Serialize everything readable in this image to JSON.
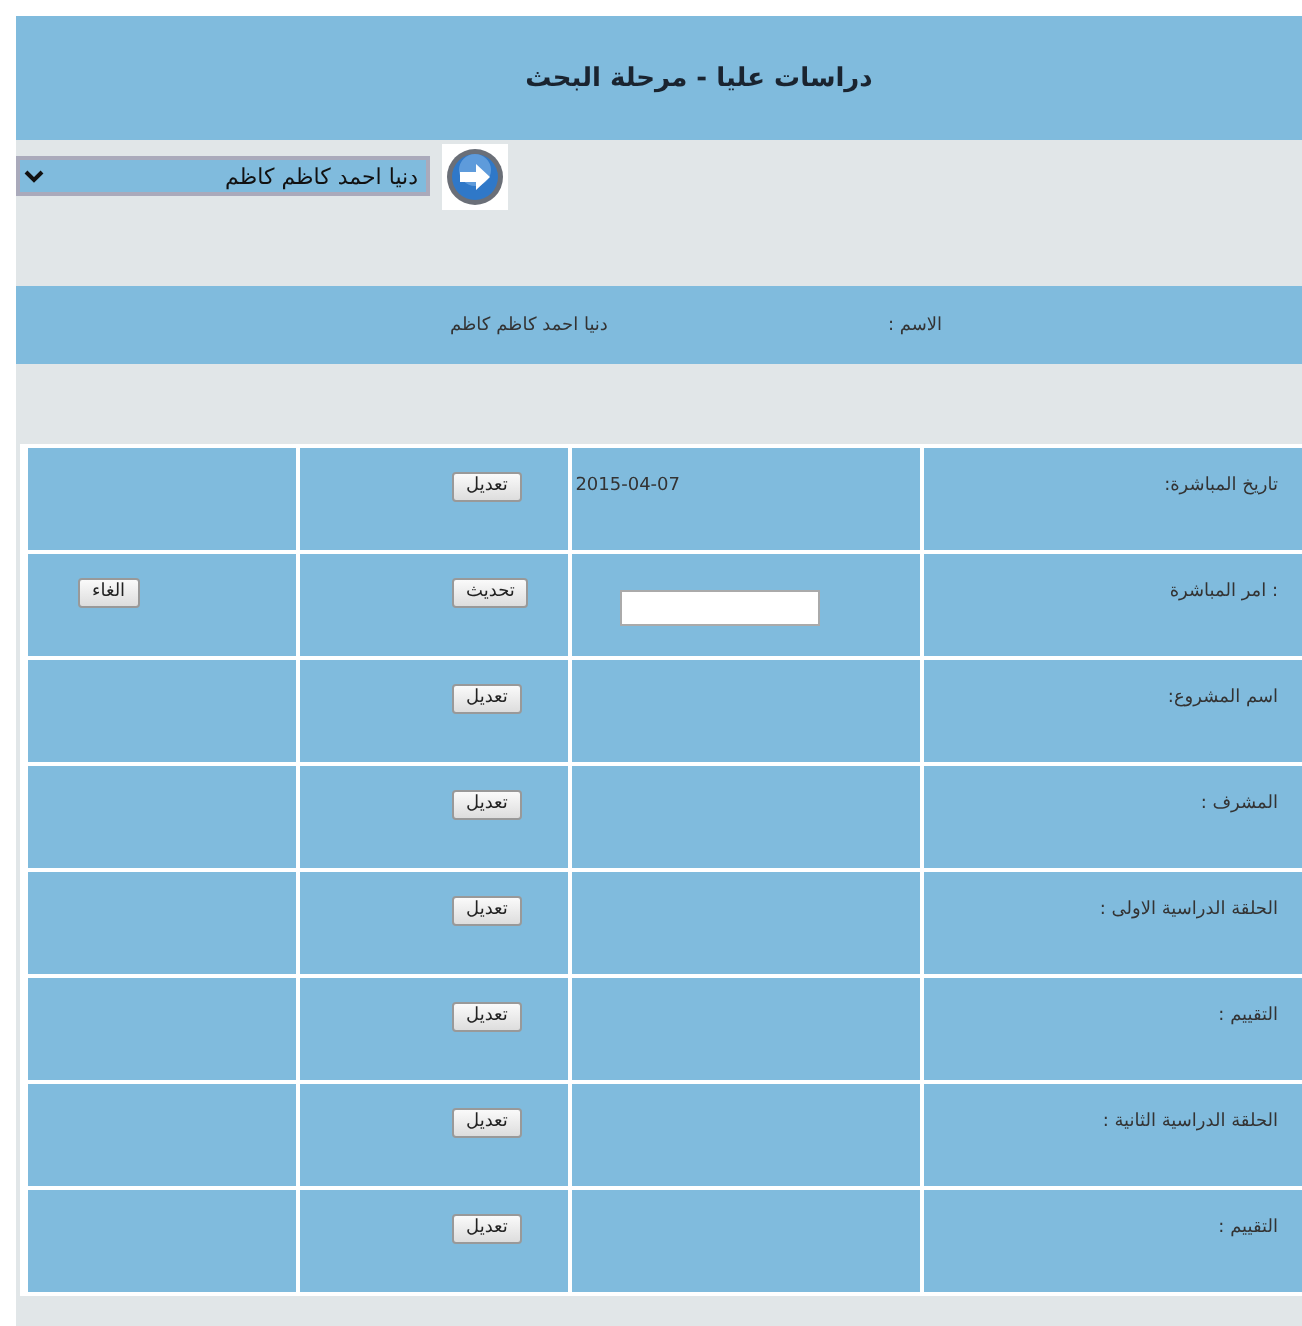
{
  "header": {
    "title": "دراسات عليا - مرحلة البحث"
  },
  "student_select": {
    "value": "دنيا احمد كاظم كاظم"
  },
  "name_band": {
    "label": "الاسم :",
    "value": "دنيا احمد كاظم كاظم"
  },
  "rows": [
    {
      "label": "تاريخ المباشرة:",
      "kind": "text",
      "value": "2015-04-07",
      "action": "تعديل"
    },
    {
      "label": ": امر المباشرة",
      "kind": "input",
      "action": "تحديث",
      "cancel": "الغاء"
    },
    {
      "label": "اسم المشروع:",
      "kind": "text",
      "action": "تعديل"
    },
    {
      "label": "المشرف :",
      "kind": "text",
      "action": "تعديل"
    },
    {
      "label": "الحلقة الدراسية الاولى :",
      "kind": "text",
      "action": "تعديل"
    },
    {
      "label": "التقييم :",
      "kind": "text",
      "action": "تعديل"
    },
    {
      "label": "الحلقة الدراسية الثانية :",
      "kind": "text",
      "action": "تعديل"
    },
    {
      "label": "التقييم :",
      "kind": "text",
      "action": "تعديل"
    }
  ]
}
